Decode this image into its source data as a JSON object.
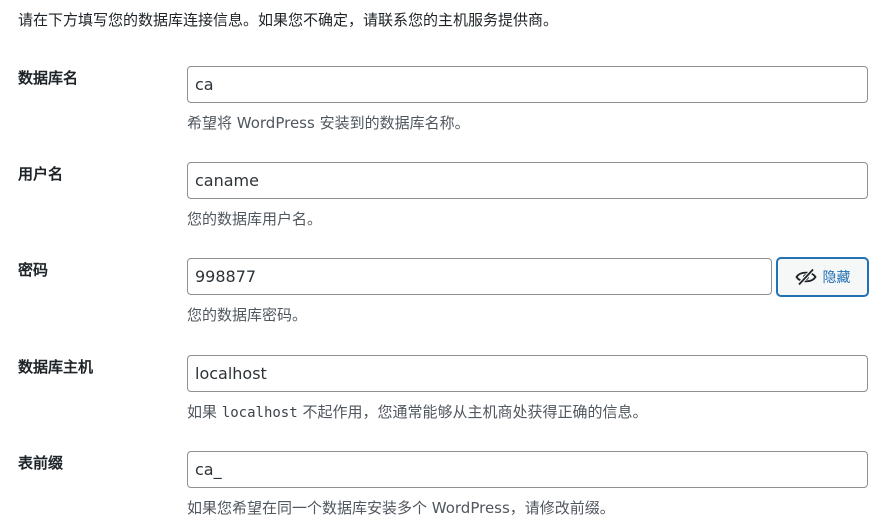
{
  "intro": "请在下方填写您的数据库连接信息。如果您不确定，请联系您的主机服务提供商。",
  "fields": {
    "dbname": {
      "label": "数据库名",
      "value": "ca",
      "description": "希望将 WordPress 安装到的数据库名称。"
    },
    "username": {
      "label": "用户名",
      "value": "caname",
      "description": "您的数据库用户名。"
    },
    "password": {
      "label": "密码",
      "value": "998877",
      "description": "您的数据库密码。",
      "toggle_label": "隐藏",
      "toggle_icon": "eye-slash-icon"
    },
    "dbhost": {
      "label": "数据库主机",
      "value": "localhost",
      "description_before": "如果",
      "description_code": "localhost",
      "description_after": "不起作用，您通常能够从主机商处获得正确的信息。"
    },
    "prefix": {
      "label": "表前缀",
      "value": "ca_",
      "description": "如果您希望在同一个数据库安装多个 WordPress，请修改前缀。"
    }
  },
  "colors": {
    "accent": "#2271b1",
    "text": "#1d2327",
    "description": "#50575e",
    "input_border": "#8c8f94"
  }
}
